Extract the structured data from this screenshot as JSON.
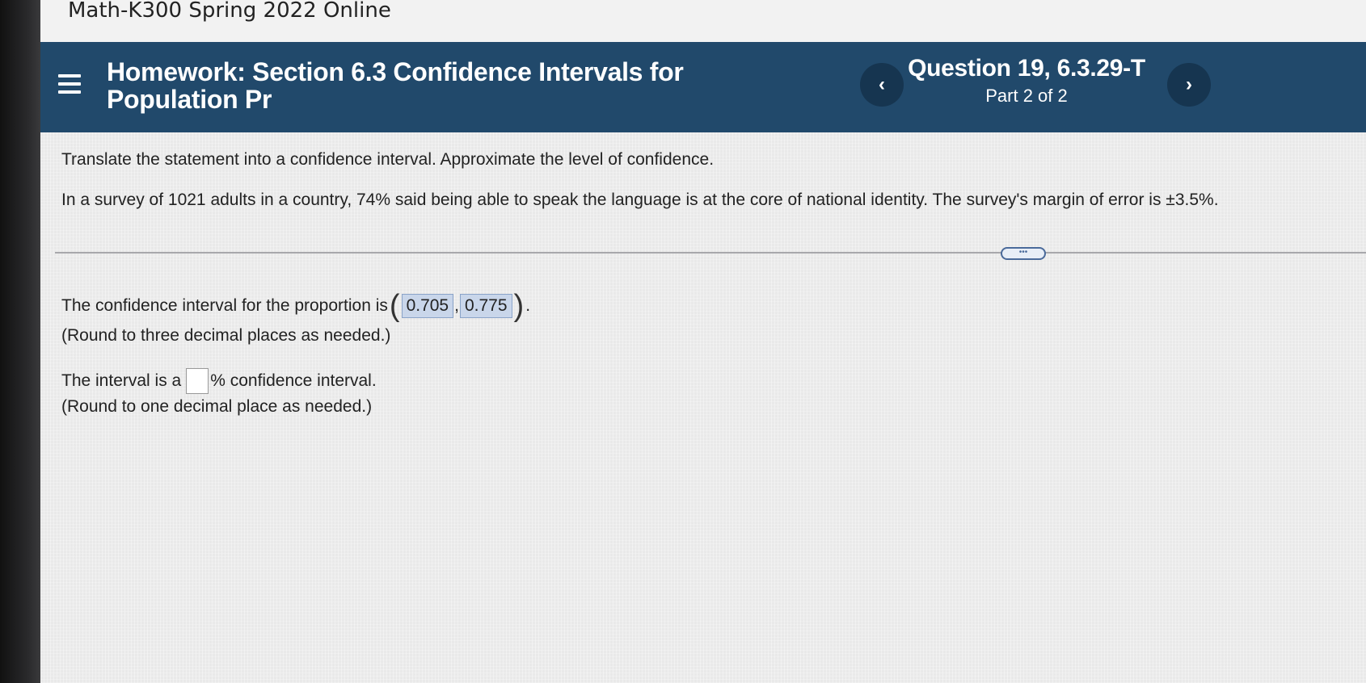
{
  "course": {
    "title": "Math-K300 Spring 2022 Online"
  },
  "homework": {
    "label": "Homework:",
    "title": "Section 6.3 Confidence Intervals for Population Pr"
  },
  "question": {
    "title": "Question 19, 6.3.29-T",
    "part": "Part 2 of 2"
  },
  "nav": {
    "prev": "‹",
    "next": "›"
  },
  "content": {
    "instruction": "Translate the statement into a confidence interval. Approximate the level of confidence.",
    "problem": "In a survey of 1021 adults in a country, 74% said being able to speak the language is at the core of national identity. The survey's margin of error is ±3.5%.",
    "more": "•••",
    "ci_prefix": "The confidence interval for the proportion is",
    "ci_lower": "0.705",
    "ci_upper": "0.775",
    "ci_round": "(Round to three decimal places as needed.)",
    "level_prefix": "The interval is a",
    "level_value": "",
    "level_suffix": "% confidence interval.",
    "level_round": "(Round to one decimal place as needed.)"
  }
}
